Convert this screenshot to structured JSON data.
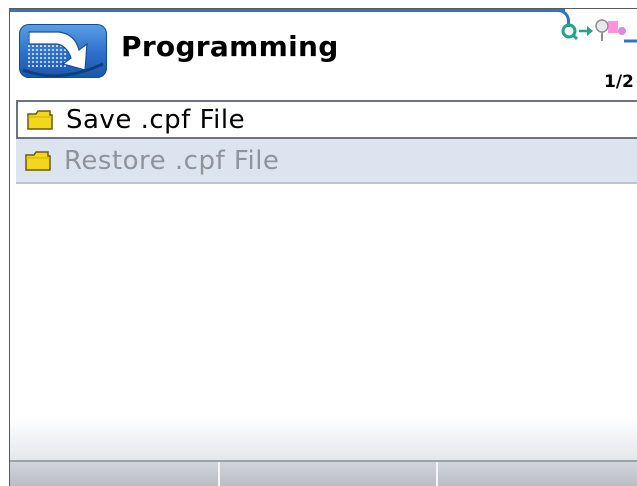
{
  "header": {
    "title": "Programming",
    "page_indicator": "1/2",
    "icon": "programming-arrow-icon"
  },
  "status_icons": [
    "network-status-icon",
    "usb-device-icon",
    "connection-arrow-icon"
  ],
  "menu": {
    "items": [
      {
        "label": "Save .cpf File",
        "icon": "folder-icon",
        "selected": true
      },
      {
        "label": "Restore .cpf File",
        "icon": "folder-icon",
        "selected": false
      }
    ]
  },
  "softkeys": [
    "",
    "",
    ""
  ],
  "colors": {
    "accent_blue": "#2f73c4",
    "folder_yellow": "#f2d71c",
    "unselected_row_bg": "#dce5ef",
    "disabled_text": "#8d949c"
  }
}
